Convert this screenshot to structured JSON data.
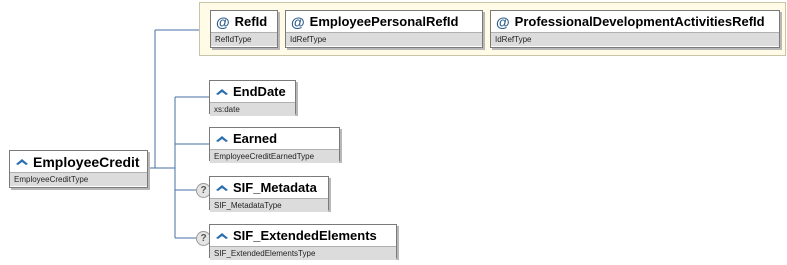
{
  "root": {
    "name": "EmployeeCredit",
    "type": "EmployeeCreditType"
  },
  "attributes": [
    {
      "name": "RefId",
      "type": "RefIdType"
    },
    {
      "name": "EmployeePersonalRefId",
      "type": "IdRefType"
    },
    {
      "name": "ProfessionalDevelopmentActivitiesRefId",
      "type": "IdRefType"
    }
  ],
  "elements": [
    {
      "name": "EndDate",
      "type": "xs:date",
      "optional": false
    },
    {
      "name": "Earned",
      "type": "EmployeeCreditEarnedType",
      "optional": false
    },
    {
      "name": "SIF_Metadata",
      "type": "SIF_MetadataType",
      "optional": true
    },
    {
      "name": "SIF_ExtendedElements",
      "type": "SIF_ExtendedElementsType",
      "optional": true
    }
  ],
  "optional_marker": "?",
  "attribute_marker": "@",
  "colors": {
    "connector": "#4a6fa5",
    "icon": "#2a6fb0",
    "attr_panel": "#fffbe6"
  }
}
